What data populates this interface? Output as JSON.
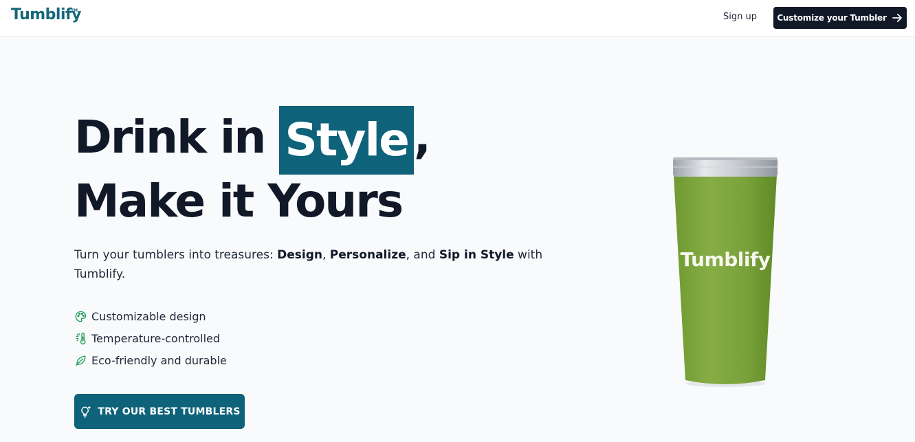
{
  "brand": {
    "name": "Tumblify",
    "trademark": "TM",
    "color": "#17677a"
  },
  "nav": {
    "signup_label": "Sign up",
    "cta_label": "Customize your Tumbler",
    "cta_icon": "arrow-right-icon"
  },
  "hero": {
    "headline_prefix": "Drink in ",
    "headline_highlight": "Style",
    "headline_comma": ",",
    "headline_line2": "Make it Yours",
    "subtitle": {
      "part1": "Turn your tumblers into treasures: ",
      "bold1": "Design",
      "sep1": ", ",
      "bold2": "Personalize",
      "sep2": ", and ",
      "bold3": "Sip in Style",
      "part2": " with Tumblify."
    },
    "features": [
      {
        "icon": "palette-icon",
        "label": "Customizable design"
      },
      {
        "icon": "thermometer-icon",
        "label": "Temperature-controlled"
      },
      {
        "icon": "leaf-icon",
        "label": "Eco-friendly and durable"
      }
    ],
    "cta_label": "TRY OUR BEST TUMBLERS",
    "cta_icon": "lightbulb-icon",
    "product_label": "Tumblify"
  },
  "colors": {
    "accent": "#0e6279",
    "dark": "#111827",
    "feature_icon": "#1f9d55",
    "tumbler_green": "#7ba33c"
  }
}
